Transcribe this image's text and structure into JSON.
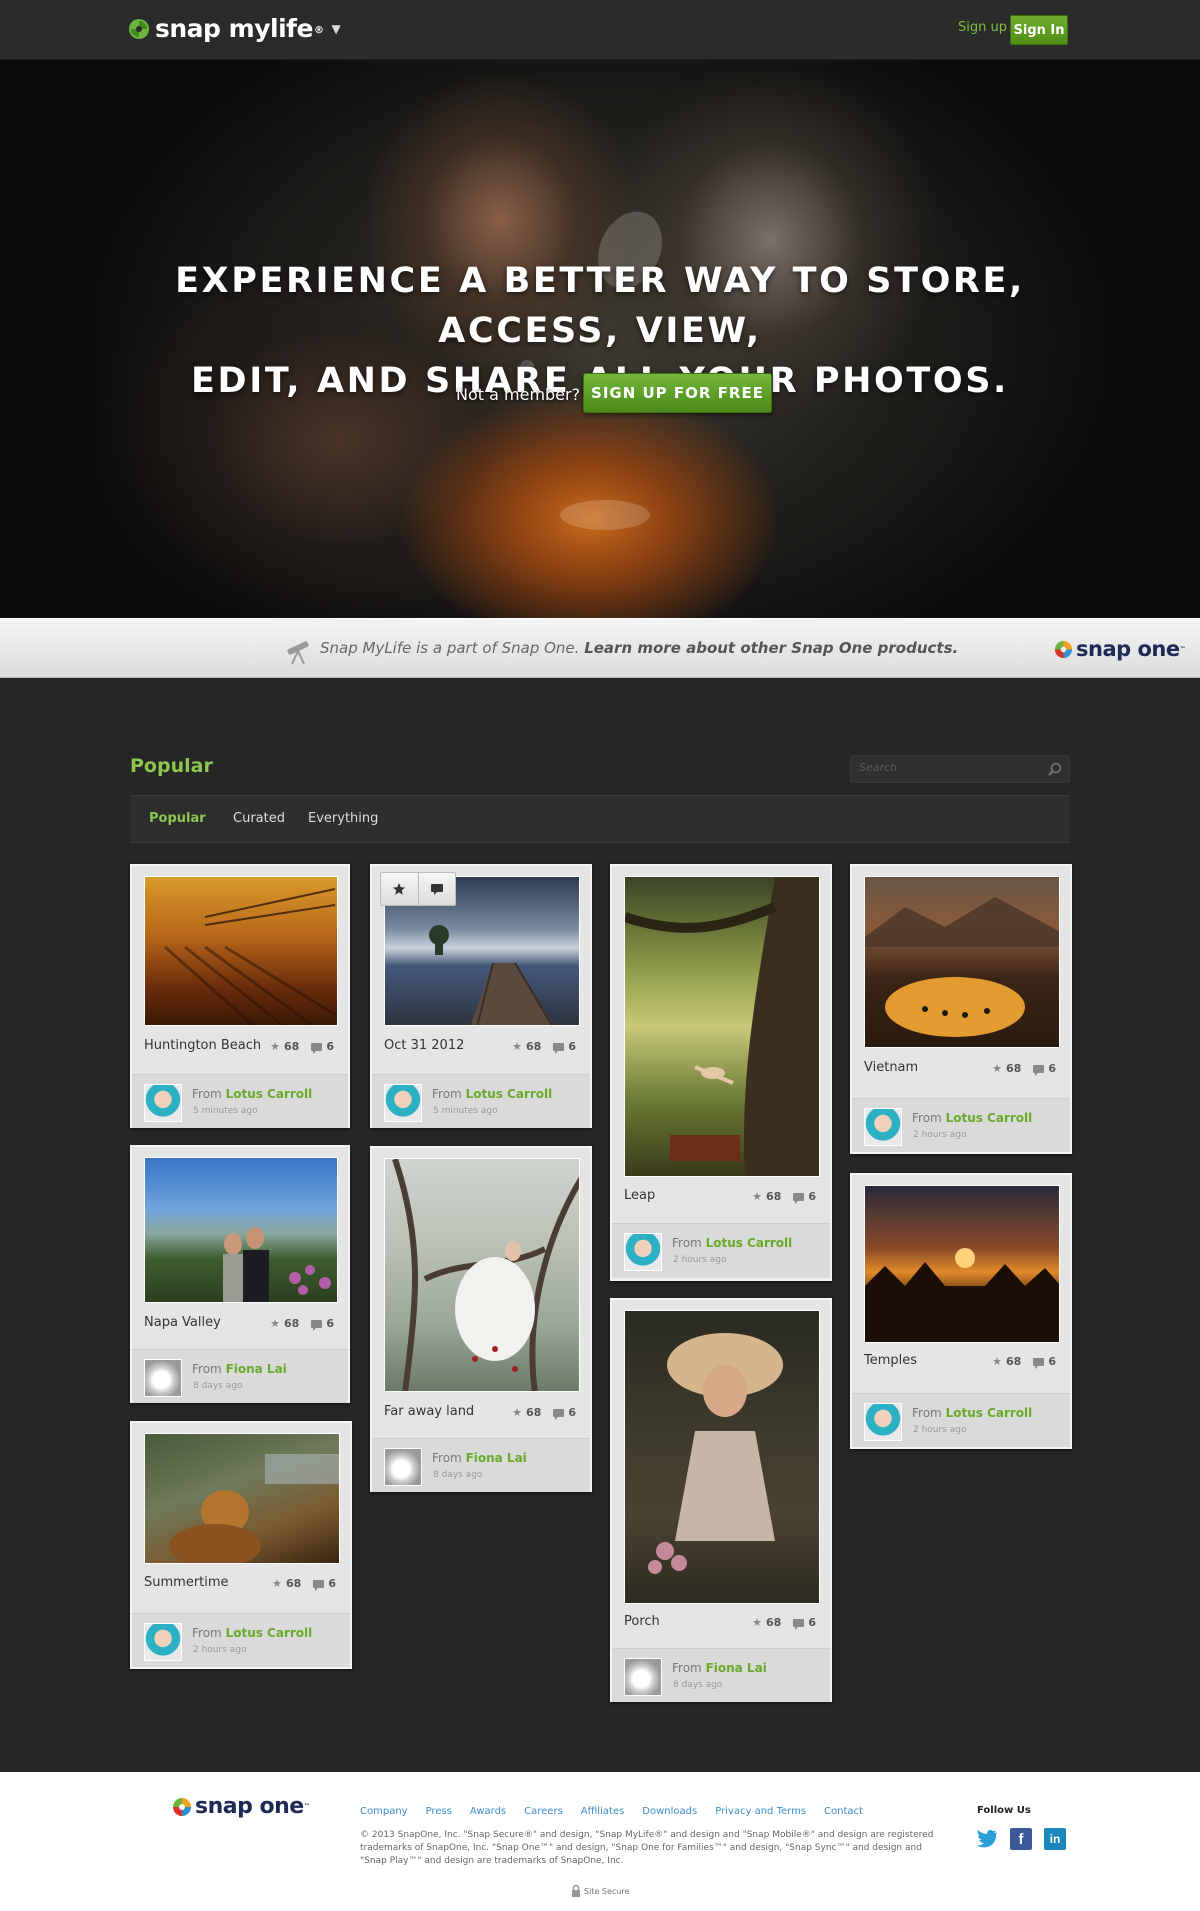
{
  "header": {
    "logo_text": "snap mylife",
    "logo_trademark": "®",
    "signup_label": "Sign up",
    "signin_label": "Sign In"
  },
  "hero": {
    "title_line1": "EXPERIENCE A BETTER WAY TO STORE, ACCESS, VIEW,",
    "title_line2": "EDIT, AND SHARE ALL YOUR PHOTOS.",
    "not_member": "Not a member?",
    "cta_label": "SIGN UP FOR FREE"
  },
  "strip": {
    "text_plain": "Snap MyLife is a part of Snap One.",
    "text_bold": "Learn more about other Snap One products.",
    "logo_text": "snap one",
    "logo_trademark": "™"
  },
  "popular": {
    "title": "Popular",
    "search_placeholder": "Search",
    "tabs": [
      "Popular",
      "Curated",
      "Everything"
    ],
    "active_tab": "Popular"
  },
  "overlay_icons": [
    "star-icon",
    "comment-icon"
  ],
  "cards": [
    {
      "caption": "Huntington Beach",
      "stars": "68",
      "comments": "6",
      "from_label": "From",
      "author": "Lotus Carroll",
      "ago": "5 minutes ago"
    },
    {
      "caption": "Napa Valley",
      "stars": "68",
      "comments": "6",
      "from_label": "From",
      "author": "Fiona Lai",
      "ago": "8 days ago"
    },
    {
      "caption": "Summertime",
      "stars": "68",
      "comments": "6",
      "from_label": "From",
      "author": "Lotus Carroll",
      "ago": "2 hours ago"
    },
    {
      "caption": "Oct 31 2012",
      "stars": "68",
      "comments": "6",
      "from_label": "From",
      "author": "Lotus Carroll",
      "ago": "5 minutes ago"
    },
    {
      "caption": "Far away land",
      "stars": "68",
      "comments": "6",
      "from_label": "From",
      "author": "Fiona Lai",
      "ago": "8 days ago"
    },
    {
      "caption": "Leap",
      "stars": "68",
      "comments": "6",
      "from_label": "From",
      "author": "Lotus Carroll",
      "ago": "2 hours ago"
    },
    {
      "caption": "Porch",
      "stars": "68",
      "comments": "6",
      "from_label": "From",
      "author": "Fiona Lai",
      "ago": "8 days ago"
    },
    {
      "caption": "Vietnam",
      "stars": "68",
      "comments": "6",
      "from_label": "From",
      "author": "Lotus Carroll",
      "ago": "2 hours ago"
    },
    {
      "caption": "Temples",
      "stars": "68",
      "comments": "6",
      "from_label": "From",
      "author": "Lotus Carroll",
      "ago": "2 hours ago"
    }
  ],
  "footer": {
    "logo_text": "snap one",
    "logo_trademark": "™",
    "links": [
      "Company",
      "Press",
      "Awards",
      "Careers",
      "Affiliates",
      "Downloads",
      "Privacy and Terms",
      "Contact"
    ],
    "legal": "© 2013 SnapOne, Inc. \"Snap Secure®\" and design, \"Snap MyLife®\" and design and \"Snap Mobile®\" and design are registered trademarks of SnapOne, Inc. \"Snap One™\" and design, \"Snap One for Families™\" and design, \"Snap Sync™\" and design and \"Snap Play™\" and design are trademarks of SnapOne, Inc.",
    "follow_label": "Follow Us",
    "social": [
      "twitter-icon",
      "facebook-icon",
      "linkedin-icon"
    ],
    "site_secure": "Site Secure"
  },
  "colors": {
    "accent_green": "#8dc54f",
    "button_green": "#5b9b20",
    "page_bg": "#262626",
    "link_blue": "#3a8fc8"
  }
}
